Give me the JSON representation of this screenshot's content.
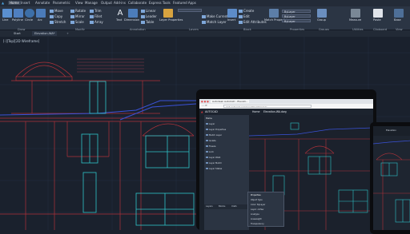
{
  "ribbon": {
    "tabs": [
      "Home",
      "Insert",
      "Annotate",
      "Parametric",
      "View",
      "Manage",
      "Output",
      "Add-ins",
      "Collaborate",
      "Express Tools",
      "Featured Apps"
    ],
    "draw": {
      "line": "Line",
      "polyline": "Polyline",
      "circle": "Circle",
      "arc": "Arc",
      "panel": "Draw"
    },
    "modify": {
      "move": "Move",
      "rotate": "Rotate",
      "trim": "Trim",
      "copy": "Copy",
      "mirror": "Mirror",
      "fillet": "Fillet",
      "stretch": "Stretch",
      "scale": "Scale",
      "array": "Array",
      "panel": "Modify"
    },
    "annotation": {
      "text": "Text",
      "dimension": "Dimension",
      "linear": "Linear",
      "leader": "Leader",
      "table": "Table",
      "panel": "Annotation"
    },
    "layers": {
      "layer_properties": "Layer Properties",
      "make_current": "Make Current",
      "match_layer": "Match Layer",
      "panel": "Layers"
    },
    "block": {
      "insert": "Insert",
      "create": "Create",
      "edit": "Edit",
      "edit_attributes": "Edit Attributes",
      "panel": "Block"
    },
    "properties": {
      "match": "Match Properties",
      "bylayer": "ByLayer",
      "panel": "Properties"
    },
    "groups": {
      "group": "Group",
      "panel": "Groups"
    },
    "utilities": {
      "measure": "Measure",
      "panel": "Utilities"
    },
    "clipboard": {
      "paste": "Paste",
      "panel": "Clipboard"
    },
    "view": {
      "base": "Base",
      "panel": "View"
    }
  },
  "doc_tabs": [
    "Start",
    "Elevation-WA*"
  ],
  "viewport_label": "[-][Top][2D Wireframe]",
  "laptop": {
    "browser_tab": "Autodesk AutoCAD - Elevati...",
    "url": "web.autocad.com/acad/me/drawings",
    "app_name": "AUTOCAD",
    "header_left": "Home",
    "header_file": "Elevation-WA.dwg",
    "panel_title": "Home",
    "panel_items": [
      "Layer",
      "Layer Properties",
      "Match Layer",
      "Isolate",
      "Freeze",
      "Lock",
      "Layer Walk",
      "Layer Match",
      "Layer States"
    ],
    "panel_tabs": [
      "Layers",
      "Blocks",
      "Xrefs"
    ],
    "popup_title": "Properties",
    "popup_items": [
      "Object Type",
      "Color: ByLayer",
      "Layer: A-Elev",
      "Linetype",
      "Lineweight",
      "Transparency"
    ]
  },
  "tablet": {
    "title": "Elevation"
  }
}
